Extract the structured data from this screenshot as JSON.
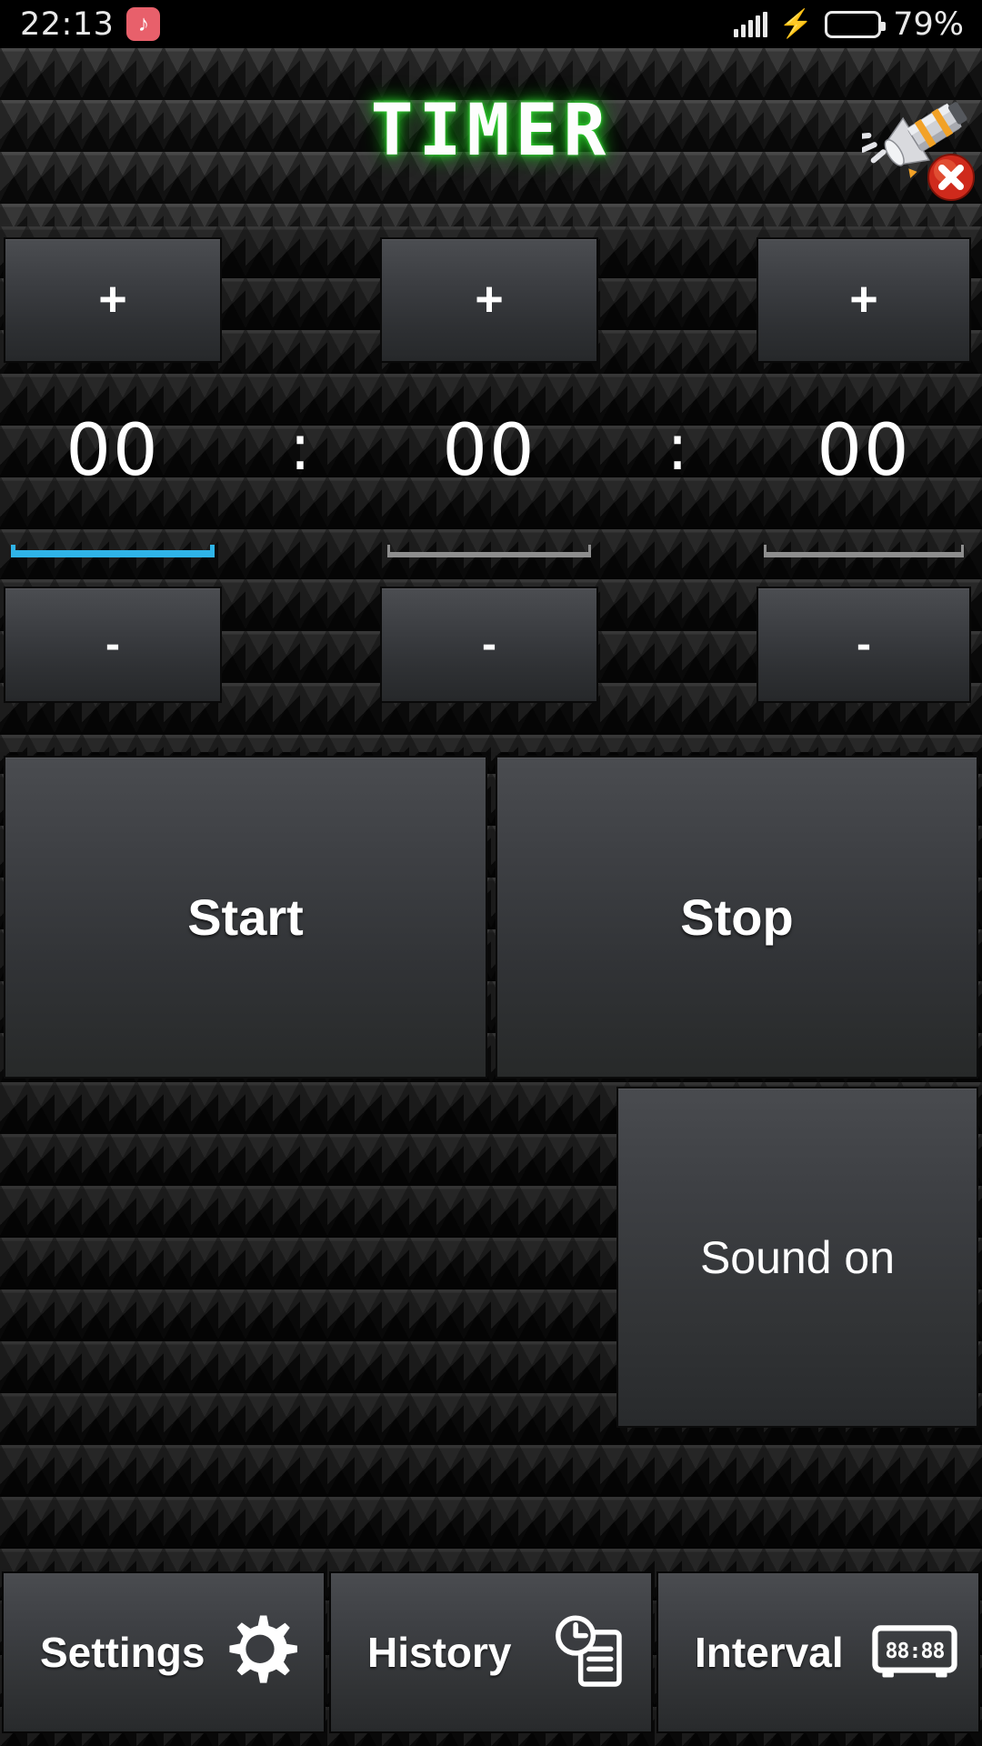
{
  "status_bar": {
    "time": "22:13",
    "music_icon": "tiktok-note-icon",
    "music_glyph": "♪",
    "signal_icon": "signal-bars-icon",
    "charging_icon": "charging-bolt-icon",
    "charging_glyph": "⚡",
    "battery_icon": "battery-icon",
    "battery_percent": "79%",
    "battery_level": 79,
    "battery_color": "#39d411"
  },
  "header": {
    "title": "TIMER",
    "title_color": "#ffffff",
    "title_glow_color": "#2bbf2b",
    "mute_button_icon": "speaker-muted-icon"
  },
  "timer": {
    "plus_label": "+",
    "minus_label": "-",
    "separator": ":",
    "focus_color": "#2fb4e8",
    "fields": [
      {
        "name": "hours",
        "value": "00",
        "focused": true
      },
      {
        "name": "minutes",
        "value": "00",
        "focused": false
      },
      {
        "name": "seconds",
        "value": "00",
        "focused": false
      }
    ]
  },
  "actions": {
    "start_label": "Start",
    "stop_label": "Stop",
    "sound_label": "Sound on"
  },
  "tabs": [
    {
      "label": "Settings",
      "icon": "gear-icon"
    },
    {
      "label": "History",
      "icon": "clock-list-icon"
    },
    {
      "label": "Interval",
      "icon": "digital-clock-icon",
      "icon_text": "88:88"
    }
  ]
}
